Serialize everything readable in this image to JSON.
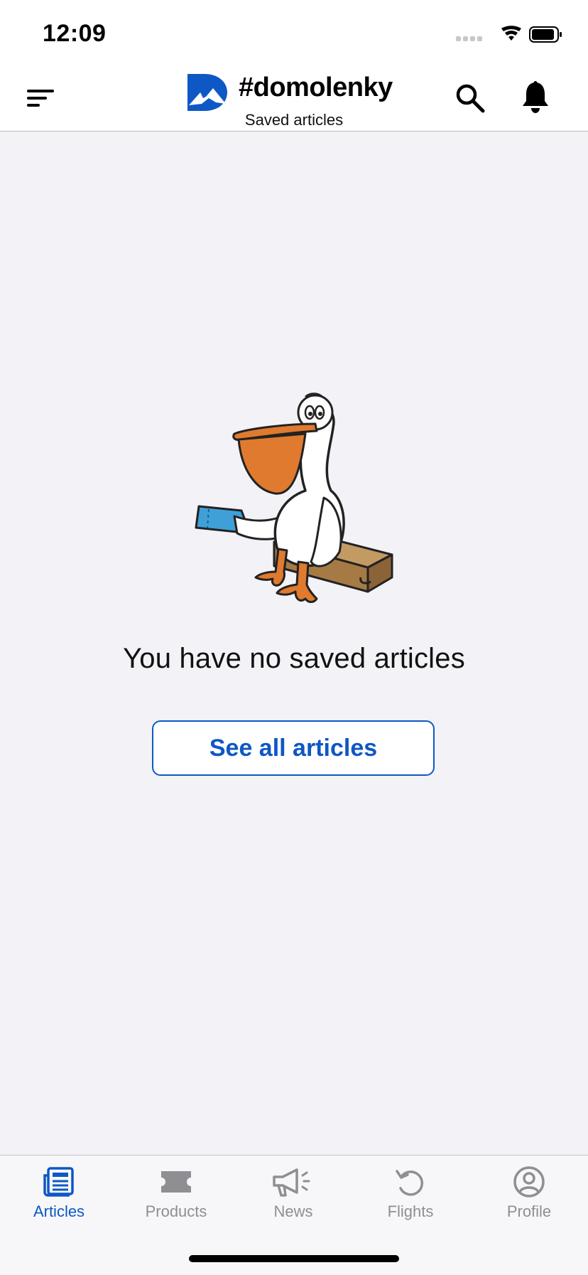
{
  "status_bar": {
    "time": "12:09",
    "icons": [
      "signal-icon",
      "wifi-icon",
      "battery-icon"
    ]
  },
  "header": {
    "brand_title": "#domolenky",
    "subtitle": "Saved articles",
    "icons": [
      "menu-icon",
      "search-icon",
      "bell-icon"
    ]
  },
  "empty_state": {
    "illustration": "pelican-with-ticket-and-suitcase",
    "message": "You have no saved articles",
    "button_label": "See all articles"
  },
  "tabs": [
    {
      "label": "Articles",
      "icon": "articles-icon",
      "active": true
    },
    {
      "label": "Products",
      "icon": "ticket-icon",
      "active": false
    },
    {
      "label": "News",
      "icon": "megaphone-icon",
      "active": false
    },
    {
      "label": "Flights",
      "icon": "history-icon",
      "active": false
    },
    {
      "label": "Profile",
      "icon": "profile-icon",
      "active": false
    }
  ],
  "colors": {
    "accent": "#0d58c4",
    "inactive": "#8e8e93",
    "background": "#f2f2f7"
  }
}
